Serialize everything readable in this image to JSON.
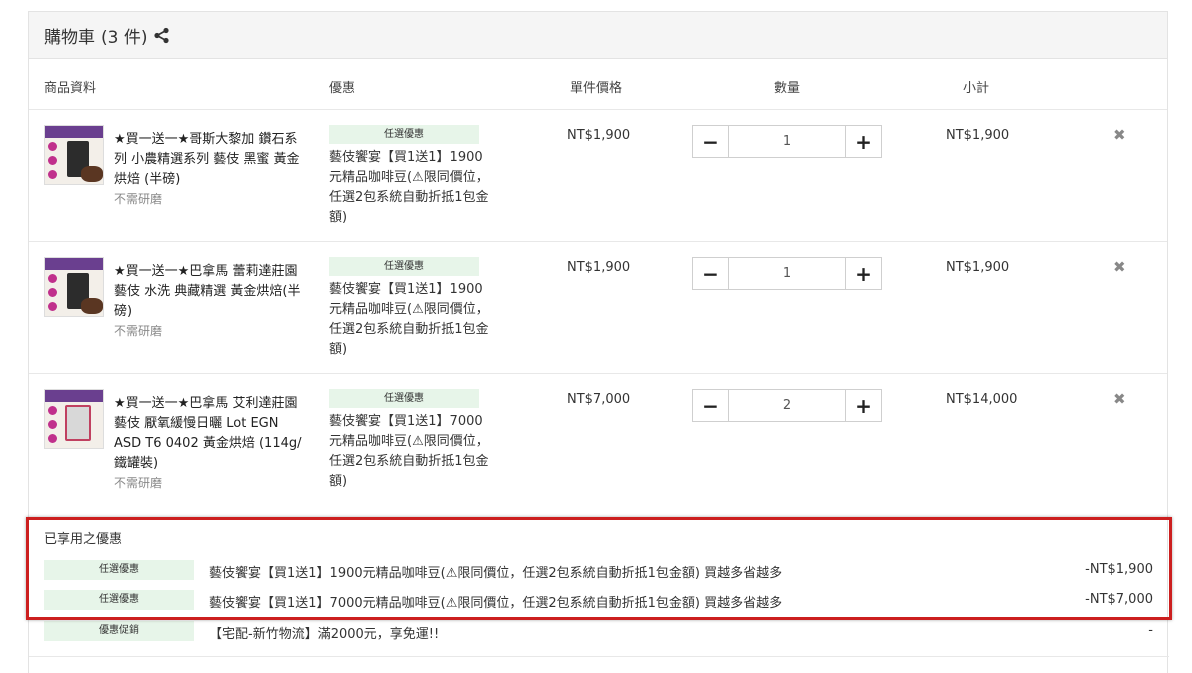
{
  "cart": {
    "title": "購物車",
    "count": "(3 件)",
    "columns": {
      "product": "商品資料",
      "promo": "優惠",
      "unit_price": "單件價格",
      "quantity": "數量",
      "subtotal": "小計"
    },
    "items": [
      {
        "name": "★買一送一★哥斯大黎加 鑽石系列 小農精選系列 藝伎 黑蜜 黃金烘焙 (半磅)",
        "note": "不需研磨",
        "promo_tag": "任選優惠",
        "promo_text": "藝伎饗宴【買1送1】1900元精品咖啡豆(⚠限同價位，任選2包系統自動折抵1包金額)",
        "price": "NT$1,900",
        "qty": "1",
        "subtotal": "NT$1,900",
        "minus": "−",
        "plus": "+",
        "remove": "✖"
      },
      {
        "name": "★買一送一★巴拿馬 蕾莉達莊園 藝伎 水洗 典藏精選 黃金烘焙(半磅)",
        "note": "不需研磨",
        "promo_tag": "任選優惠",
        "promo_text": "藝伎饗宴【買1送1】1900元精品咖啡豆(⚠限同價位，任選2包系統自動折抵1包金額)",
        "price": "NT$1,900",
        "qty": "1",
        "subtotal": "NT$1,900",
        "minus": "−",
        "plus": "+",
        "remove": "✖"
      },
      {
        "name": "★買一送一★巴拿馬 艾利達莊園 藝伎 厭氧緩慢日曬 Lot EGN ASD T6 0402 黃金烘焙 (114g/鐵罐裝)",
        "note": "不需研磨",
        "promo_tag": "任選優惠",
        "promo_text": "藝伎饗宴【買1送1】7000元精品咖啡豆(⚠限同價位，任選2包系統自動折抵1包金額)",
        "price": "NT$7,000",
        "qty": "2",
        "subtotal": "NT$14,000",
        "minus": "−",
        "plus": "+",
        "remove": "✖"
      }
    ]
  },
  "applied": {
    "title": "已享用之優惠",
    "rows": [
      {
        "tag": "任選優惠",
        "text": "藝伎饗宴【買1送1】1900元精品咖啡豆(⚠限同價位，任選2包系統自動折抵1包金額) 買越多省越多",
        "amount": "-NT$1,900"
      },
      {
        "tag": "任選優惠",
        "text": "藝伎饗宴【買1送1】7000元精品咖啡豆(⚠限同價位，任選2包系統自動折抵1包金額) 買越多省越多",
        "amount": "-NT$7,000"
      },
      {
        "tag": "優惠促銷",
        "text": "【宅配-新竹物流】滿2000元，享免運!!",
        "amount": "-"
      }
    ]
  },
  "colors": {
    "header_bg": "#f5f5f5",
    "tag_bg": "#e7f5e9",
    "highlight": "#cc1f1f"
  }
}
